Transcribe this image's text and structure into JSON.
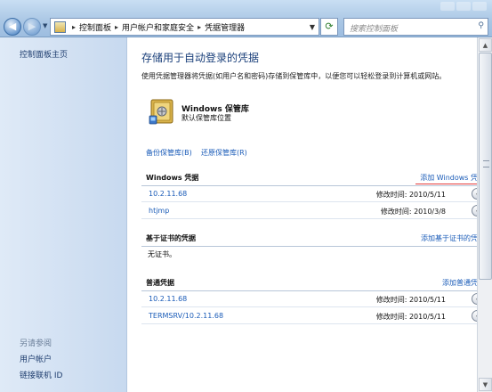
{
  "addressbar": {
    "crumbs": [
      "控制面板",
      "用户帐户和家庭安全",
      "凭据管理器"
    ],
    "search_placeholder": "搜索控制面板"
  },
  "leftpane": {
    "home": "控制面板主页",
    "see_also": "另请参阅",
    "links": [
      "用户帐户",
      "链接联机 ID"
    ]
  },
  "main": {
    "title": "存储用于自动登录的凭据",
    "description": "使用凭据管理器将凭据(如用户名和密码)存储到保管库中，以便您可以轻松登录到计算机或网站。",
    "vault": {
      "title": "Windows 保管库",
      "subtitle": "默认保管库位置"
    },
    "backup_link": "备份保管库(B)",
    "restore_link": "还原保管库(R)",
    "sections": [
      {
        "name": "Windows 凭据",
        "add_label": "添加 Windows 凭据",
        "rows": [
          {
            "name": "10.2.11.68",
            "modified": "修改时间: 2010/5/11"
          },
          {
            "name": "htjmp",
            "modified": "修改时间: 2010/3/8"
          }
        ]
      },
      {
        "name": "基于证书的凭据",
        "add_label": "添加基于证书的凭据",
        "empty_text": "无证书。",
        "rows": []
      },
      {
        "name": "普通凭据",
        "add_label": "添加普通凭据",
        "rows": [
          {
            "name": "10.2.11.68",
            "modified": "修改时间: 2010/5/11"
          },
          {
            "name": "TERMSRV/10.2.11.68",
            "modified": "修改时间: 2010/5/11"
          }
        ]
      }
    ]
  },
  "colors": {
    "link": "#1b5cb8",
    "title": "#1a3f7a",
    "highlight_underline": "#e33a3a"
  }
}
